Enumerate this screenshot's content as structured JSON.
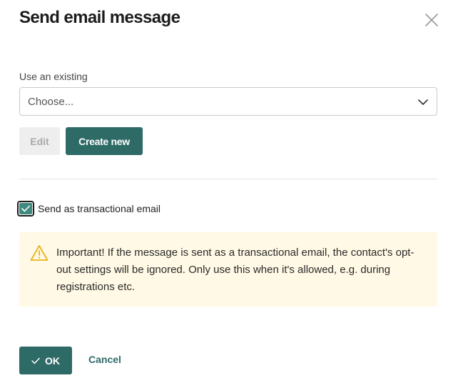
{
  "dialog": {
    "title": "Send email message",
    "close_icon": "close-icon"
  },
  "existing": {
    "label": "Use an existing",
    "selected": "Choose...",
    "icon": "chevron-down-icon"
  },
  "buttons": {
    "edit": "Edit",
    "create_new": "Create new",
    "ok": "OK",
    "cancel": "Cancel"
  },
  "transactional": {
    "checked": true,
    "label": "Send as transactional email"
  },
  "alert": {
    "icon": "warning-icon",
    "text": "Important! If the message is sent as a transactional email, the contact's opt-out settings will be ignored. Only use this when it's allowed, e.g. during registrations etc."
  },
  "colors": {
    "primary": "#2e6a66",
    "checkbox_fill": "#3f8a7e",
    "alert_bg": "#fff9e5",
    "warning": "#e7b318"
  }
}
